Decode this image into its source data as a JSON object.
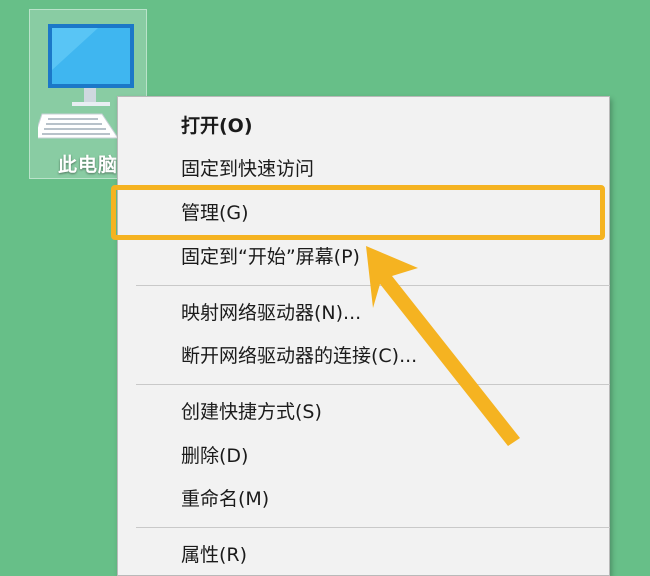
{
  "desktop": {
    "background_color": "#67bf88",
    "icon": {
      "label": "此电脑",
      "icon_name": "computer-icon"
    }
  },
  "context_menu": {
    "items": [
      {
        "label": "打开(O)",
        "bold": true
      },
      {
        "label": "固定到快速访问"
      },
      {
        "label": "管理(G)",
        "highlighted": true
      },
      {
        "label": "固定到“开始”屏幕(P)"
      },
      {
        "label": "映射网络驱动器(N)..."
      },
      {
        "label": "断开网络驱动器的连接(C)..."
      },
      {
        "label": "创建快捷方式(S)"
      },
      {
        "label": "删除(D)"
      },
      {
        "label": "重命名(M)"
      },
      {
        "label": "属性(R)"
      }
    ]
  },
  "annotation": {
    "highlight_color": "#f5b321",
    "arrow_icon": "pointer-arrow-icon"
  }
}
